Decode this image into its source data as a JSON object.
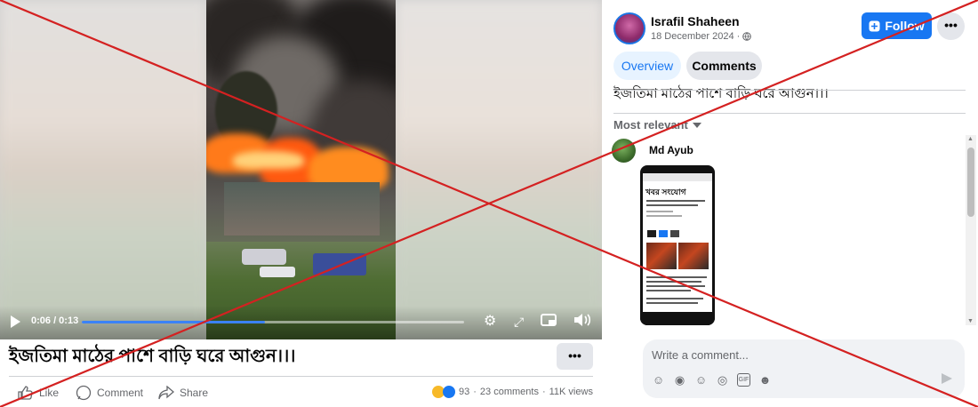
{
  "video": {
    "time": "0:06 / 0:13",
    "progress": 0.48
  },
  "post": {
    "title": "ইজতিমা মাঠের পাশে বাড়ি ঘরে আগুন।।।",
    "author": "Israfil Shaheen",
    "date": "18 December 2024 ·",
    "follow_label": "Follow",
    "more_label": "•••",
    "actions": {
      "like": "Like",
      "comment": "Comment",
      "share": "Share"
    },
    "stats": {
      "reactions": "93",
      "comments": "23 comments",
      "views": "11K views",
      "sep": "·"
    }
  },
  "tabs": {
    "overview": "Overview",
    "comments": "Comments"
  },
  "sort_label": "Most relevant",
  "comment": {
    "author": "Md Ayub",
    "attachment_brand": "খবর সংযোগ"
  },
  "composer": {
    "placeholder": "Write a comment..."
  },
  "icons": {
    "play": "play-icon",
    "settings": "gear-icon",
    "fullscreen": "expand-icon",
    "pip": "pip-icon",
    "volume": "volume-icon",
    "globe": "globe-icon",
    "send": "send-icon"
  },
  "colors": {
    "accent": "#1877f2",
    "overlay_x": "#d42121"
  }
}
